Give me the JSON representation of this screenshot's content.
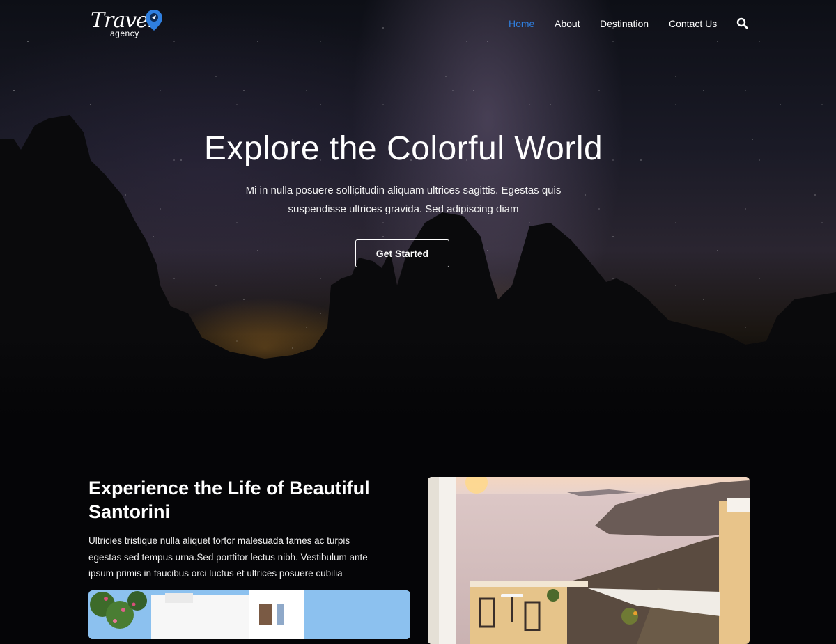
{
  "brand": {
    "logo_word": "Travel",
    "logo_sub": "agency",
    "accent_color": "#2f7fdf"
  },
  "nav": {
    "items": [
      {
        "label": "Home",
        "active": true
      },
      {
        "label": "About",
        "active": false
      },
      {
        "label": "Destination",
        "active": false
      },
      {
        "label": "Contact Us",
        "active": false
      }
    ],
    "search_icon": "search-icon"
  },
  "hero": {
    "title": "Explore the Colorful World",
    "subtitle_line1": "Mi in nulla posuere sollicitudin aliquam ultrices sagittis. Egestas quis",
    "subtitle_line2": "suspendisse ultrices gravida. Sed adipiscing diam",
    "cta_label": "Get Started"
  },
  "section": {
    "title": "Experience the Life of Beautiful Santorini",
    "body_line1": "Ultricies tristique nulla aliquet tortor malesuada fames ac turpis",
    "body_line2": "egestas sed tempus urna.Sed porttitor lectus nibh. Vestibulum ante",
    "body_line3": "ipsum primis in faucibus orci luctus et ultrices posuere cubilia"
  }
}
